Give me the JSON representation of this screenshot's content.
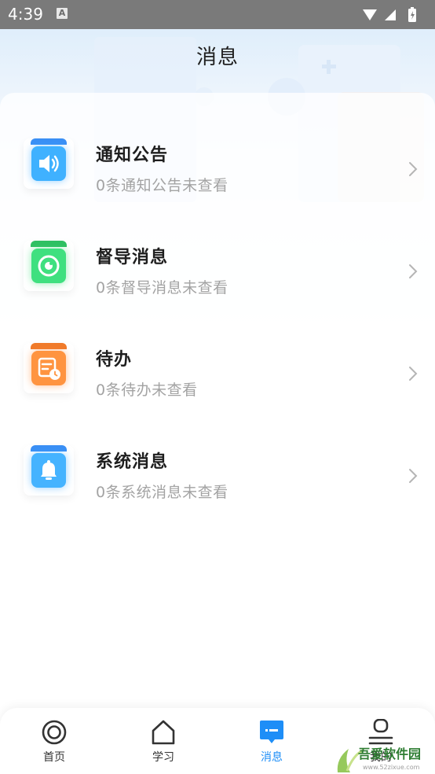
{
  "statusbar": {
    "time": "4:39",
    "indicator": "A"
  },
  "header": {
    "title": "消息"
  },
  "messages": [
    {
      "title": "通知公告",
      "subtitle": "0条通知公告未查看",
      "icon": "speaker-icon",
      "color": "#35a0ff"
    },
    {
      "title": "督导消息",
      "subtitle": "0条督导消息未查看",
      "icon": "eye-circle-icon",
      "color": "#37dc7c"
    },
    {
      "title": "待办",
      "subtitle": "0条待办未查看",
      "icon": "todo-clock-icon",
      "color": "#ff8a33"
    },
    {
      "title": "系统消息",
      "subtitle": "0条系统消息未查看",
      "icon": "bell-icon",
      "color": "#3fa7ff"
    }
  ],
  "tabbar": {
    "tabs": [
      {
        "label": "首页",
        "icon": "target-icon",
        "active": false
      },
      {
        "label": "学习",
        "icon": "house-icon",
        "active": false
      },
      {
        "label": "消息",
        "icon": "message-icon",
        "active": true
      },
      {
        "label": "我的",
        "icon": "person-icon",
        "active": false
      }
    ],
    "active_color": "#1e8ef7",
    "inactive_color": "#333333"
  },
  "watermark": {
    "text": "吾爱软件园",
    "url": "www.52zixue.com"
  }
}
